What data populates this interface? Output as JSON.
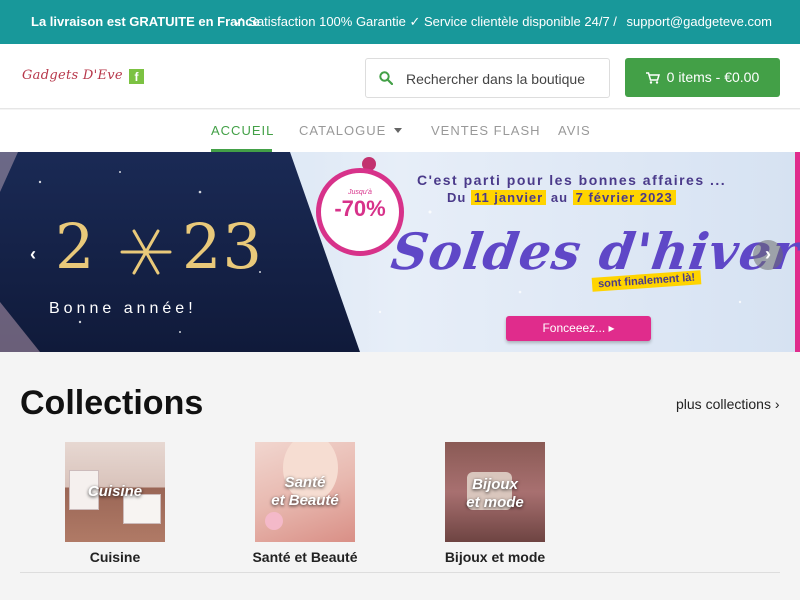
{
  "topbar": {
    "left": "La livraison est GRATUITE en France",
    "right1": "✓ Satisfaction 100% Garantie",
    "right2": "✓ Service clientèle disponible 24/7",
    "sep": "/",
    "email": "support@gadgeteve.com"
  },
  "header": {
    "logo_text": "Gadgets D'Eve",
    "facebook_icon": "f",
    "search_placeholder": "Rechercher dans la boutique",
    "cart_label": "0 items - €0.00"
  },
  "nav": {
    "items": [
      {
        "label": "ACCUEIL"
      },
      {
        "label": "CATALOGUE"
      },
      {
        "label": "VENTES FLASH"
      },
      {
        "label": "AVIS"
      }
    ]
  },
  "banner": {
    "year": "2023",
    "greeting": "Bonne année!",
    "badge_small": "Jusqu'à",
    "badge_pct": "-70%",
    "line1": "C'est parti pour les bonnes affaires ...",
    "line2_prefix": "Du ",
    "date1": "11 janvier",
    "line2_mid": " au ",
    "date2": "7 février 2023",
    "headline": "Soldes d'hiver",
    "sub": "sont finalement là!",
    "cta": "Fonceeez... ▸",
    "prev": "‹",
    "next": "›"
  },
  "collections": {
    "title": "Collections",
    "more": "plus collections ›",
    "items": [
      {
        "label": "Cuisine",
        "caption": "Cuisine"
      },
      {
        "label": "Santé et Beauté",
        "caption1": "Santé",
        "caption2": "et Beauté"
      },
      {
        "label": "Bijoux et mode",
        "caption1": "Bijoux",
        "caption2": "et mode"
      }
    ]
  },
  "colors": {
    "topbar": "#18989a",
    "accent": "#43a047",
    "promo": "#e02c8c"
  }
}
